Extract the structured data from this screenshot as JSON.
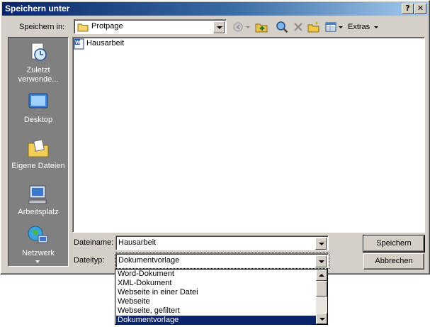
{
  "window": {
    "title": "Speichern unter",
    "help_glyph": "?",
    "close_glyph": "✕"
  },
  "toolbar": {
    "look_in_label": "Speichern in:",
    "look_in_value": "Protpage",
    "extras_label": "Extras",
    "icons": [
      "back-icon",
      "up-folder-icon",
      "search-web-icon",
      "delete-icon",
      "new-folder-icon",
      "views-icon"
    ]
  },
  "places": [
    {
      "label": "Zuletzt verwende...",
      "icon": "recent-clock-icon"
    },
    {
      "label": "Desktop",
      "icon": "desktop-icon"
    },
    {
      "label": "Eigene Dateien",
      "icon": "folder-documents-icon"
    },
    {
      "label": "Arbeitsplatz",
      "icon": "computer-icon"
    },
    {
      "label": "Netzwerk",
      "icon": "network-globe-icon"
    }
  ],
  "files": [
    {
      "name": "Hausarbeit",
      "icon": "word-document-icon"
    }
  ],
  "filename": {
    "label": "Dateiname:",
    "value": "Hausarbeit"
  },
  "filetype": {
    "label": "Dateityp:",
    "value": "Dokumentvorlage",
    "options": [
      "Word-Dokument",
      "XML-Dokument",
      "Webseite in einer Datei",
      "Webseite",
      "Webseite, gefiltert",
      "Dokumentvorlage"
    ],
    "selected_index": 5
  },
  "buttons": {
    "save": "Speichern",
    "cancel": "Abbrechen"
  },
  "colors": {
    "titlebar_start": "#0a246a",
    "titlebar_end": "#a6caf0",
    "face": "#d4d0c8",
    "places_bg": "#808080",
    "selection": "#0a246a"
  }
}
